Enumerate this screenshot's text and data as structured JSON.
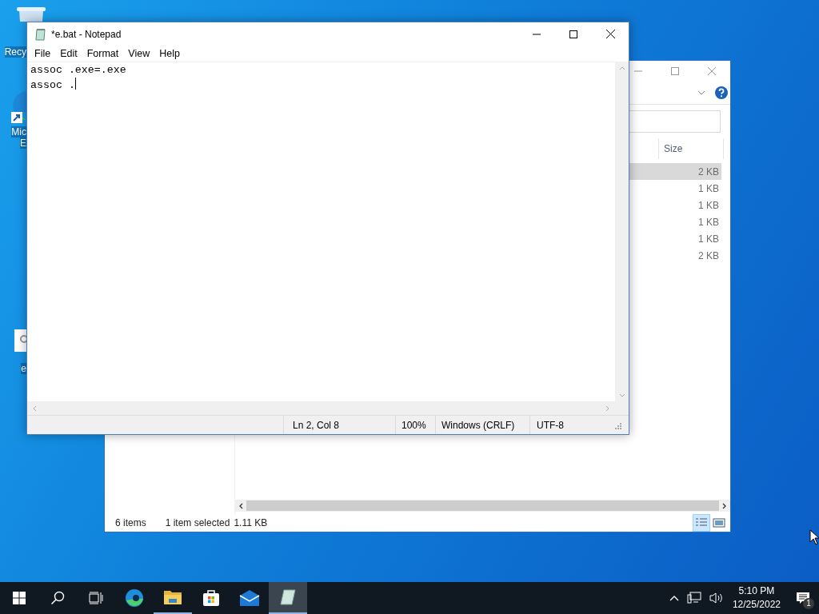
{
  "desktop_icons": [
    {
      "kind": "recycle-bin",
      "lines": [
        "Recy"
      ]
    },
    {
      "kind": "browser",
      "lines": [
        "Mic",
        "E"
      ]
    },
    {
      "kind": "batch-file",
      "lines": [
        "e"
      ]
    }
  ],
  "explorer": {
    "size_header": "Size",
    "files": [
      {
        "size": "2 KB",
        "selected": true
      },
      {
        "size": "1 KB",
        "selected": false
      },
      {
        "size": "1 KB",
        "selected": false
      },
      {
        "size": "1 KB",
        "selected": false
      },
      {
        "size": "1 KB",
        "selected": false
      },
      {
        "size": "2 KB",
        "selected": false
      }
    ],
    "status": {
      "count": "6 items",
      "selection": "1 item selected",
      "size": "1.11 KB"
    },
    "views": [
      {
        "kind": "details",
        "selected": true
      },
      {
        "kind": "large-icons",
        "selected": false
      }
    ]
  },
  "notepad": {
    "title": "*e.bat - Notepad",
    "menu": [
      "File",
      "Edit",
      "Format",
      "View",
      "Help"
    ],
    "lines": [
      "assoc .exe=.exe",
      "assoc ."
    ],
    "status": {
      "position": "Ln 2, Col 8",
      "zoom": "100%",
      "line_ending": "Windows (CRLF)",
      "encoding": "UTF-8"
    }
  },
  "taskbar": {
    "apps": [
      {
        "kind": "browser",
        "running": false,
        "selected": false
      },
      {
        "kind": "folder",
        "running": true,
        "selected": false
      },
      {
        "kind": "store",
        "running": false,
        "selected": false
      },
      {
        "kind": "mail",
        "running": false,
        "selected": false
      },
      {
        "kind": "notepad",
        "running": true,
        "selected": true
      }
    ],
    "time": "5:10 PM",
    "date": "12/25/2022",
    "notifications": "1"
  }
}
